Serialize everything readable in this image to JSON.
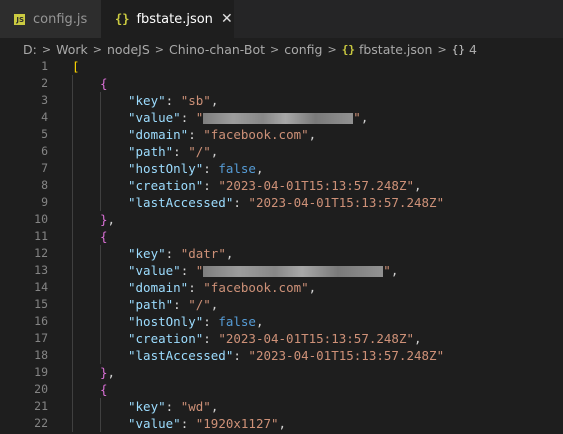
{
  "tabs": [
    {
      "label": "config.js",
      "icon": "js-file-icon",
      "active": false
    },
    {
      "label": "fbstate.json",
      "icon": "json-file-icon",
      "active": true
    }
  ],
  "breadcrumb": {
    "items": [
      "D:",
      "Work",
      "nodeJS",
      "Chino-chan-Bot",
      "config",
      "fbstate.json",
      "4"
    ]
  },
  "editor": {
    "lines": [
      {
        "n": "1",
        "indent": 0,
        "tokens": [
          {
            "t": "[",
            "c": "b1"
          }
        ]
      },
      {
        "n": "2",
        "indent": 1,
        "tokens": []
      },
      {
        "n": "3",
        "indent": 1,
        "tokens": [
          {
            "t": "{",
            "c": "b2"
          }
        ]
      },
      {
        "n": "4",
        "indent": 2,
        "tokens": []
      },
      {
        "n": "5",
        "indent": 2,
        "tokens": [
          {
            "t": "\"key\"",
            "c": "k"
          },
          {
            "t": ": ",
            "c": "p"
          },
          {
            "t": "\"sb\"",
            "c": "s"
          },
          {
            "t": ",",
            "c": "p"
          }
        ]
      },
      {
        "n": "6",
        "indent": 2,
        "tokens": [
          {
            "t": "\"value\"",
            "c": "k"
          },
          {
            "t": ": ",
            "c": "p"
          },
          {
            "t": "\"",
            "c": "s"
          },
          {
            "blur": 150
          },
          {
            "t": "\"",
            "c": "s"
          },
          {
            "t": ",",
            "c": "p"
          }
        ]
      },
      {
        "n": "7",
        "indent": 2,
        "tokens": [
          {
            "t": "\"domain\"",
            "c": "k"
          },
          {
            "t": ": ",
            "c": "p"
          },
          {
            "t": "\"facebook.com\"",
            "c": "s"
          },
          {
            "t": ",",
            "c": "p"
          }
        ]
      },
      {
        "n": "8",
        "indent": 2,
        "tokens": [
          {
            "t": "\"path\"",
            "c": "k"
          },
          {
            "t": ": ",
            "c": "p"
          },
          {
            "t": "\"/\"",
            "c": "s"
          },
          {
            "t": ",",
            "c": "p"
          }
        ]
      },
      {
        "n": "9",
        "indent": 2,
        "tokens": [
          {
            "t": "\"hostOnly\"",
            "c": "k"
          },
          {
            "t": ": ",
            "c": "p"
          },
          {
            "t": "false",
            "c": "kw"
          },
          {
            "t": ",",
            "c": "p"
          }
        ]
      },
      {
        "n": "10",
        "indent": 2,
        "tokens": [
          {
            "t": "\"creation\"",
            "c": "k"
          },
          {
            "t": ": ",
            "c": "p"
          },
          {
            "t": "\"2023-04-01T15:13:57.248Z\"",
            "c": "s"
          },
          {
            "t": ",",
            "c": "p"
          }
        ]
      },
      {
        "n": "11",
        "indent": 2,
        "tokens": [
          {
            "t": "\"lastAccessed\"",
            "c": "k"
          },
          {
            "t": ": ",
            "c": "p"
          },
          {
            "t": "\"2023-04-01T15:13:57.248Z\"",
            "c": "s"
          }
        ]
      },
      {
        "n": "12",
        "indent": 1,
        "tokens": [
          {
            "t": "}",
            "c": "b2"
          },
          {
            "t": ",",
            "c": "p"
          }
        ]
      },
      {
        "n": "13",
        "indent": 1,
        "tokens": [
          {
            "t": "{",
            "c": "b2"
          }
        ]
      },
      {
        "n": "14",
        "indent": 2,
        "tokens": []
      },
      {
        "n": "15",
        "indent": 2,
        "tokens": [
          {
            "t": "\"key\"",
            "c": "k"
          },
          {
            "t": ": ",
            "c": "p"
          },
          {
            "t": "\"datr\"",
            "c": "s"
          },
          {
            "t": ",",
            "c": "p"
          }
        ]
      },
      {
        "n": "16",
        "indent": 2,
        "tokens": [
          {
            "t": "\"value\"",
            "c": "k"
          },
          {
            "t": ": ",
            "c": "p"
          },
          {
            "t": "\"",
            "c": "s"
          },
          {
            "blur": 180
          },
          {
            "t": "\"",
            "c": "s"
          },
          {
            "t": ",",
            "c": "p"
          }
        ]
      },
      {
        "n": "17",
        "indent": 2,
        "tokens": [
          {
            "t": "\"domain\"",
            "c": "k"
          },
          {
            "t": ": ",
            "c": "p"
          },
          {
            "t": "\"facebook.com\"",
            "c": "s"
          },
          {
            "t": ",",
            "c": "p"
          }
        ]
      },
      {
        "n": "18",
        "indent": 2,
        "tokens": [
          {
            "t": "\"path\"",
            "c": "k"
          },
          {
            "t": ": ",
            "c": "p"
          },
          {
            "t": "\"/\"",
            "c": "s"
          },
          {
            "t": ",",
            "c": "p"
          }
        ]
      },
      {
        "n": "19",
        "indent": 2,
        "tokens": [
          {
            "t": "\"hostOnly\"",
            "c": "k"
          },
          {
            "t": ": ",
            "c": "p"
          },
          {
            "t": "false",
            "c": "kw"
          },
          {
            "t": ",",
            "c": "p"
          }
        ]
      },
      {
        "n": "20",
        "indent": 2,
        "tokens": [
          {
            "t": "\"creation\"",
            "c": "k"
          },
          {
            "t": ": ",
            "c": "p"
          },
          {
            "t": "\"2023-04-01T15:13:57.248Z\"",
            "c": "s"
          },
          {
            "t": ",",
            "c": "p"
          }
        ]
      },
      {
        "n": "21",
        "indent": 2,
        "tokens": [
          {
            "t": "\"lastAccessed\"",
            "c": "k"
          },
          {
            "t": ": ",
            "c": "p"
          },
          {
            "t": "\"2023-04-01T15:13:57.248Z\"",
            "c": "s"
          }
        ]
      },
      {
        "n": "22",
        "indent": 1,
        "tokens": [
          {
            "t": "}",
            "c": "b2"
          },
          {
            "t": ",",
            "c": "p"
          }
        ]
      }
    ],
    "tail": [
      {
        "n": "20",
        "indent": 1,
        "tokens": [
          {
            "t": "{",
            "c": "b2"
          }
        ]
      },
      {
        "n": "21",
        "indent": 2,
        "tokens": [
          {
            "t": "\"key\"",
            "c": "k"
          },
          {
            "t": ": ",
            "c": "p"
          },
          {
            "t": "\"wd\"",
            "c": "s"
          },
          {
            "t": ",",
            "c": "p"
          }
        ]
      },
      {
        "n": "22",
        "indent": 2,
        "tokens": [
          {
            "t": "\"value\"",
            "c": "k"
          },
          {
            "t": ": ",
            "c": "p"
          },
          {
            "t": "\"1920x1127\"",
            "c": "s"
          },
          {
            "t": ",",
            "c": "p"
          }
        ]
      }
    ]
  },
  "colors": {
    "background": "#1e1e1e",
    "key": "#9cdcfe",
    "string": "#ce9178",
    "keyword": "#569cd6",
    "bracket_outer": "#ffd700",
    "bracket_inner": "#da70d6"
  }
}
